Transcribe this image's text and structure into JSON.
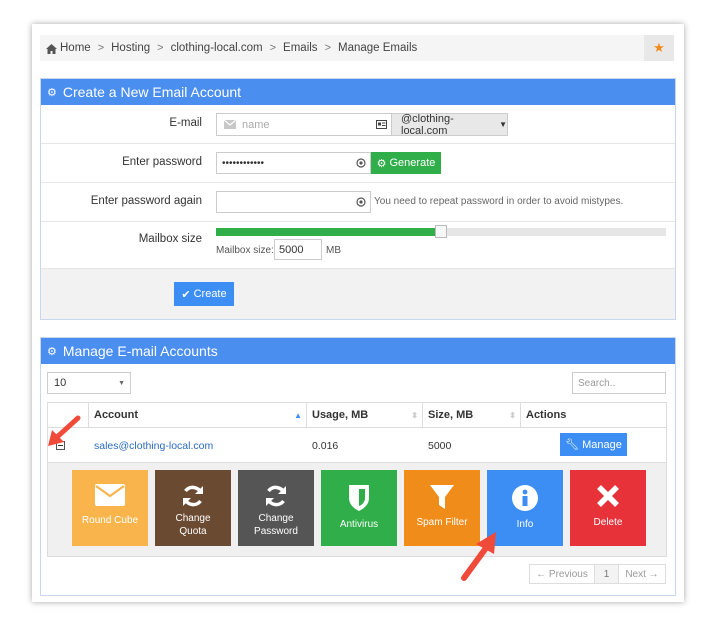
{
  "breadcrumb": {
    "items": [
      "Home",
      "Hosting",
      "clothing-local.com",
      "Emails",
      "Manage Emails"
    ]
  },
  "create_panel": {
    "title": "Create a New Email Account",
    "email_label": "E-mail",
    "email_placeholder": "name",
    "domain": "@clothing-local.com",
    "password_label": "Enter password",
    "password_value": "••••••••••••",
    "generate_label": "Generate",
    "password_again_label": "Enter password again",
    "repeat_hint": "You need to repeat password in order to avoid mistypes.",
    "mailbox_label": "Mailbox size",
    "mailbox_size_label": "Mailbox size:",
    "mailbox_size_value": "5000",
    "mailbox_unit": "MB",
    "slider_fraction": 0.5,
    "create_label": "Create"
  },
  "manage_panel": {
    "title": "Manage E-mail Accounts",
    "page_size": "10",
    "search_placeholder": "Search..",
    "columns": [
      "Account",
      "Usage, MB",
      "Size, MB",
      "Actions"
    ],
    "row": {
      "account": "sales@clothing-local.com",
      "usage": "0.016",
      "size": "5000",
      "manage_label": "Manage"
    },
    "tiles": [
      {
        "label": "Round Cube",
        "icon": "envelope-icon",
        "color": "#f9b54c"
      },
      {
        "label": "Change Quota",
        "icon": "refresh-icon",
        "color": "#6b4a32"
      },
      {
        "label": "Change Password",
        "icon": "refresh-icon",
        "color": "#555555"
      },
      {
        "label": "Antivirus",
        "icon": "shield-icon",
        "color": "#2fae4a"
      },
      {
        "label": "Spam Filter",
        "icon": "filter-icon",
        "color": "#f08c1a"
      },
      {
        "label": "Info",
        "icon": "info-icon",
        "color": "#3c8ef5"
      },
      {
        "label": "Delete",
        "icon": "close-icon",
        "color": "#e8323a"
      }
    ],
    "pagination": {
      "previous": "← Previous",
      "page": "1",
      "next": "Next →"
    }
  }
}
